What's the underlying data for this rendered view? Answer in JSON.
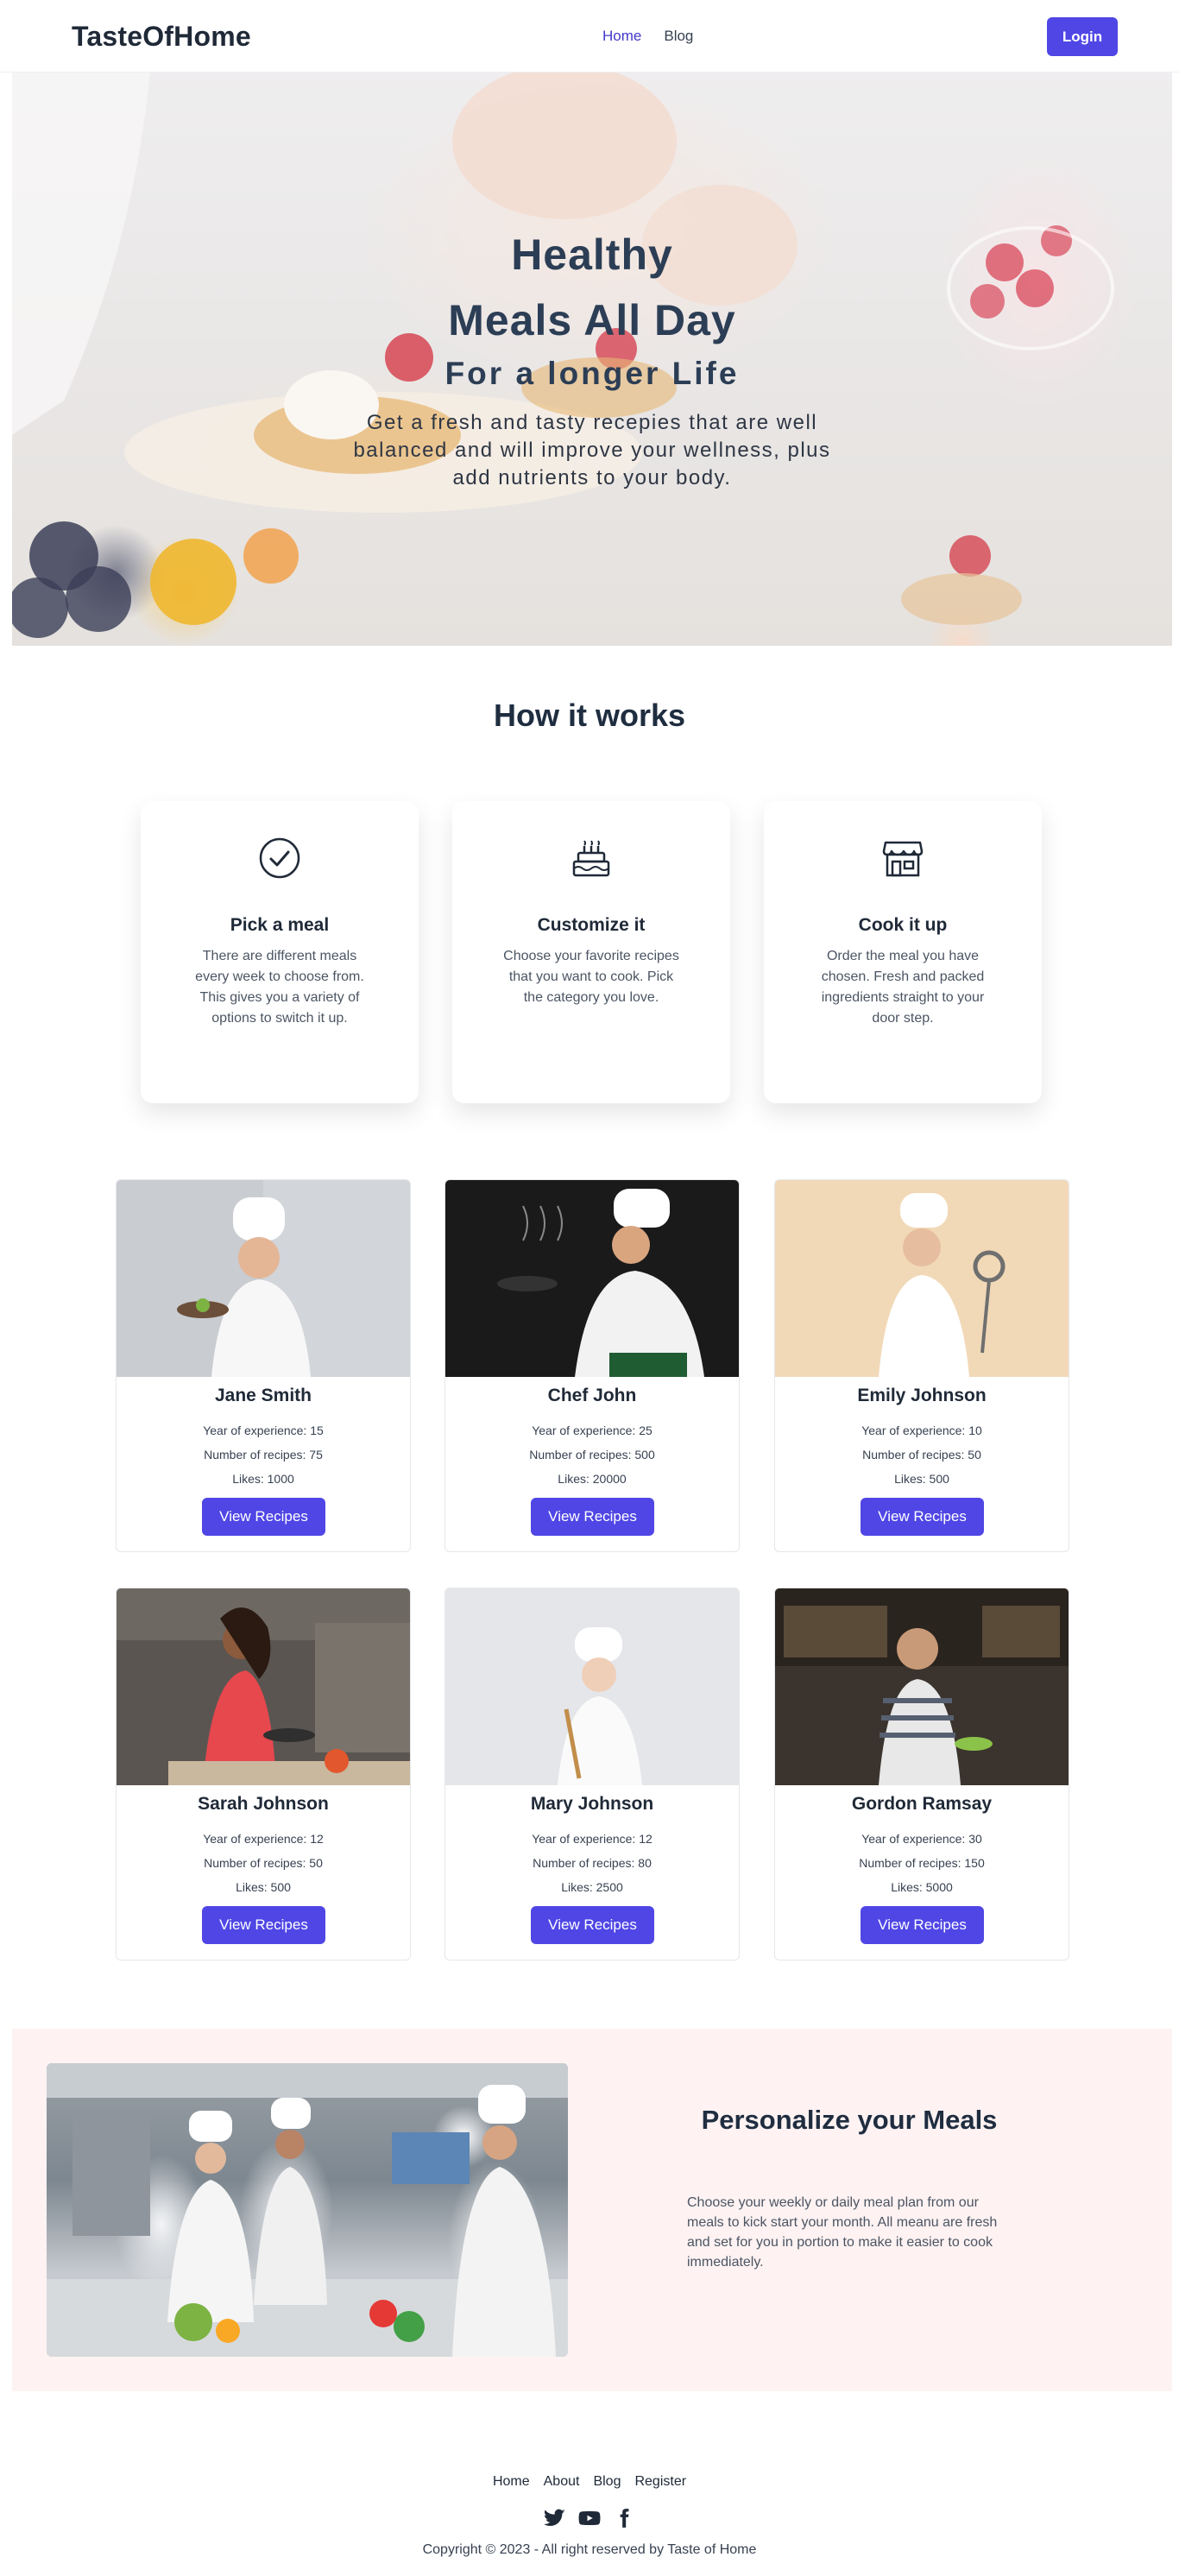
{
  "nav": {
    "logo": "TasteOfHome",
    "links": [
      {
        "label": "Home",
        "active": true
      },
      {
        "label": "Blog",
        "active": false
      }
    ],
    "login_label": "Login"
  },
  "hero": {
    "line1": "Healthy",
    "line2": "Meals All Day",
    "subtitle": "For a longer Life",
    "description": "Get a fresh and tasty recepies that are well balanced and will improve your wellness, plus add nutrients to your body."
  },
  "how": {
    "title": "How it works",
    "steps": [
      {
        "icon": "check-circle-icon",
        "title": "Pick a meal",
        "text": "There are different meals every week to choose from. This gives you a variety of options to switch it up."
      },
      {
        "icon": "cake-icon",
        "title": "Customize it",
        "text": "Choose your favorite recipes that you want to cook. Pick the category you love."
      },
      {
        "icon": "store-icon",
        "title": "Cook it up",
        "text": "Order the meal you have chosen. Fresh and packed ingredients straight to your door step."
      }
    ]
  },
  "chefs": [
    {
      "name": "Jane Smith",
      "experience": "Year of experience: 15",
      "recipes": "Number of recipes: 75",
      "likes": "Likes: 1000",
      "button": "View Recipes"
    },
    {
      "name": "Chef John",
      "experience": "Year of experience: 25",
      "recipes": "Number of recipes: 500",
      "likes": "Likes: 20000",
      "button": "View Recipes"
    },
    {
      "name": "Emily Johnson",
      "experience": "Year of experience: 10",
      "recipes": "Number of recipes: 50",
      "likes": "Likes: 500",
      "button": "View Recipes"
    },
    {
      "name": "Sarah Johnson",
      "experience": "Year of experience: 12",
      "recipes": "Number of recipes: 50",
      "likes": "Likes: 500",
      "button": "View Recipes"
    },
    {
      "name": "Mary Johnson",
      "experience": "Year of experience: 12",
      "recipes": "Number of recipes: 80",
      "likes": "Likes: 2500",
      "button": "View Recipes"
    },
    {
      "name": "Gordon Ramsay",
      "experience": "Year of experience: 30",
      "recipes": "Number of recipes: 150",
      "likes": "Likes: 5000",
      "button": "View Recipes"
    }
  ],
  "personalize": {
    "title": "Personalize your Meals",
    "text": "Choose your weekly or daily meal plan from our meals to kick start your month. All meanu are fresh and set for you in portion to make it easier to cook immediately."
  },
  "footer": {
    "links": [
      "Home",
      "About",
      "Blog",
      "Register"
    ],
    "social": [
      "twitter-icon",
      "youtube-icon",
      "facebook-icon"
    ],
    "copyright": "Copyright © 2023 - All right reserved by Taste of Home"
  },
  "colors": {
    "accent": "#4f46e5",
    "heading": "#1f2d40",
    "personalize_bg": "#fef2f2"
  }
}
